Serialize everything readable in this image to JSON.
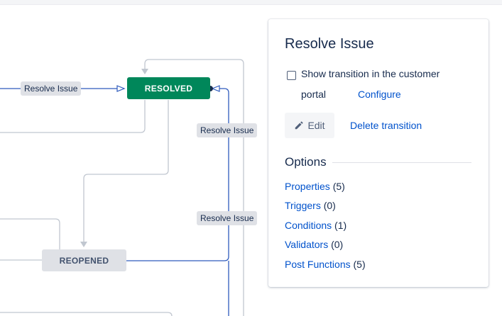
{
  "diagram": {
    "statuses": {
      "resolved": "RESOLVED",
      "reopened": "REOPENED"
    },
    "transition_labels": [
      "Resolve Issue",
      "Resolve Issue",
      "Resolve Issue"
    ]
  },
  "panel": {
    "title": "Resolve Issue",
    "checkbox_label_line1": "Show transition in the customer",
    "checkbox_label_line2": "portal",
    "configure_link": "Configure",
    "edit_label": "Edit",
    "delete_label": "Delete transition",
    "options_heading": "Options",
    "options": [
      {
        "label": "Properties",
        "count": "(5)"
      },
      {
        "label": "Triggers",
        "count": "(0)"
      },
      {
        "label": "Conditions",
        "count": "(1)"
      },
      {
        "label": "Validators",
        "count": "(0)"
      },
      {
        "label": "Post Functions",
        "count": "(5)"
      }
    ]
  },
  "colors": {
    "resolved": "#00875a",
    "reopened": "#dfe1e6",
    "link": "#0052cc",
    "connector": "#2e5bbd",
    "connector_muted": "#c1c7d0"
  }
}
